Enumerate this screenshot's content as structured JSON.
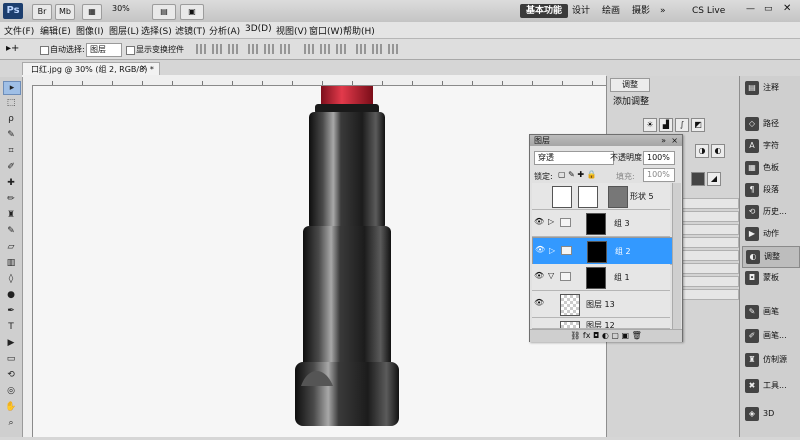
{
  "app": {
    "logo": "Ps",
    "zoom": "30%"
  },
  "workspace": {
    "active": "基本功能",
    "others": [
      "设计",
      "绘画",
      "摄影",
      "»"
    ],
    "cslive": "CS Live"
  },
  "menu": [
    "文件(F)",
    "编辑(E)",
    "图像(I)",
    "图层(L)",
    "选择(S)",
    "滤镜(T)",
    "分析(A)",
    "3D(D)",
    "视图(V)",
    "窗口(W)",
    "帮助(H)"
  ],
  "options": {
    "auto_select_label": "自动选择:",
    "auto_select_value": "图层",
    "transform_label": "显示变换控件"
  },
  "document": {
    "tab_title": "口红.jpg @ 30% (组 2, RGB/8) *"
  },
  "adjustments": {
    "tab": "调整",
    "title": "添加调整"
  },
  "layers": {
    "title": "图层",
    "blend_mode": "穿透",
    "opacity_label": "不透明度:",
    "opacity_value": "100%",
    "lock_label": "锁定:",
    "fill_label": "填充:",
    "fill_value": "100%",
    "rows": [
      {
        "name": "形状 5"
      },
      {
        "name": "组 3"
      },
      {
        "name": "组 2"
      },
      {
        "name": "组 1"
      },
      {
        "name": "图层 13"
      },
      {
        "name": "图层 12"
      }
    ]
  },
  "dock": [
    {
      "label": "注释",
      "icon": "note-icon"
    },
    {
      "label": "路径",
      "icon": "paths-icon"
    },
    {
      "label": "字符",
      "icon": "character-icon"
    },
    {
      "label": "色板",
      "icon": "swatches-icon"
    },
    {
      "label": "段落",
      "icon": "paragraph-icon"
    },
    {
      "label": "历史...",
      "icon": "history-icon"
    },
    {
      "label": "动作",
      "icon": "actions-icon"
    },
    {
      "label": "调整",
      "icon": "adjustments-icon"
    },
    {
      "label": "蒙板",
      "icon": "masks-icon"
    },
    {
      "label": "画笔",
      "icon": "brush-icon"
    },
    {
      "label": "画笔...",
      "icon": "brush-presets-icon"
    },
    {
      "label": "仿制源",
      "icon": "clone-source-icon"
    },
    {
      "label": "工具...",
      "icon": "tool-presets-icon"
    },
    {
      "label": "3D",
      "icon": "3d-icon"
    }
  ]
}
